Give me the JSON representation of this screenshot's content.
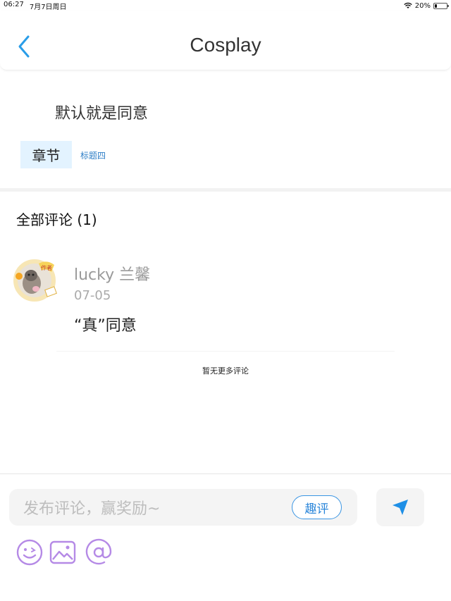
{
  "status_bar": {
    "time": "06:27",
    "date": "7月7日周日",
    "battery": "20%",
    "battery_level": 0.2
  },
  "nav": {
    "title": "Cosplay",
    "back_icon": "chevron-left-icon"
  },
  "article": {
    "text": "默认就是同意",
    "chapter_tag": "章节",
    "chapter_title": "标题四"
  },
  "comments": {
    "header": "全部评论 (1)",
    "items": [
      {
        "user": "lucky 兰馨",
        "date": "07-05",
        "text": "“真”同意",
        "avatar_badge": "作者"
      }
    ],
    "no_more": "暂无更多评论"
  },
  "composer": {
    "placeholder": "发布评论，赢奖励~",
    "fun_button": "趣评",
    "send_icon": "send-icon",
    "tools": [
      "emoji-icon",
      "image-icon",
      "mention-icon"
    ]
  },
  "colors": {
    "accent": "#2a86da",
    "tag_bg": "#e3f3ff",
    "tool_icon": "#b58ae6"
  }
}
